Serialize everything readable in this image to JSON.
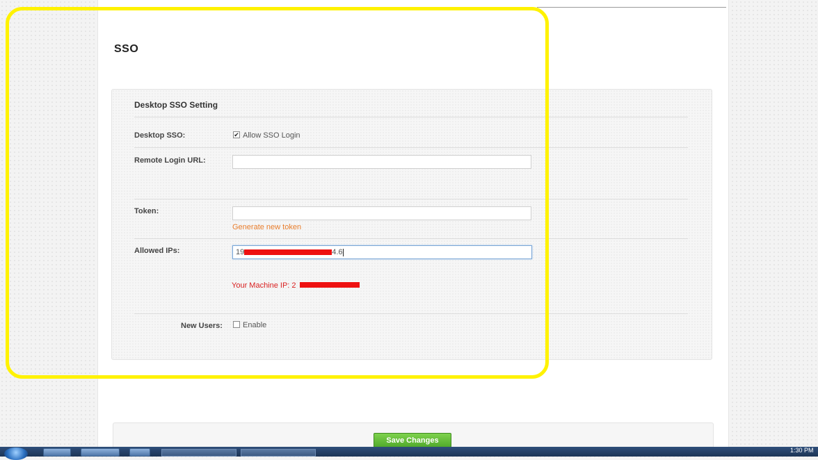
{
  "page": {
    "title": "SSO"
  },
  "panel": {
    "title": "Desktop SSO Setting",
    "desktop_sso": {
      "label": "Desktop SSO:",
      "checkbox_label": "Allow SSO Login",
      "checked": true
    },
    "remote_login_url": {
      "label": "Remote Login URL:",
      "value": ""
    },
    "token": {
      "label": "Token:",
      "value": "",
      "generate_link": "Generate new token"
    },
    "allowed_ips": {
      "label": "Allowed IPs:",
      "value_prefix": "19",
      "value_suffix": "4.6"
    },
    "machine_ip": {
      "label": "Your Machine IP: 2"
    },
    "new_users": {
      "label": "New Users:",
      "checkbox_label": "Enable",
      "checked": false
    }
  },
  "footer": {
    "save_label": "Save Changes"
  },
  "taskbar": {
    "clock": "1:30 PM"
  },
  "colors": {
    "highlight": "#fff200",
    "save_button": "#5fbf35",
    "link": "#e87d2c",
    "ip_note": "#d92020"
  }
}
